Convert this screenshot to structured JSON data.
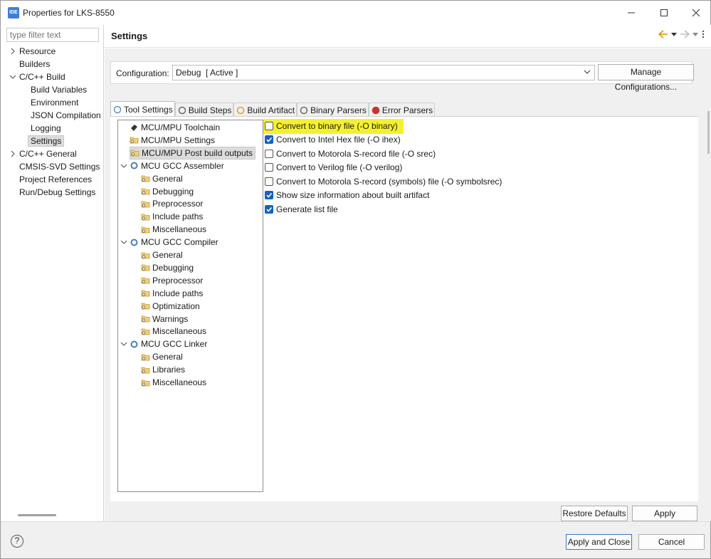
{
  "window": {
    "app_icon_text": "IDE",
    "title": "Properties for LKS-8550"
  },
  "left": {
    "filter_placeholder": "type filter text",
    "items": [
      {
        "label": "Resource",
        "expander": "collapsed"
      },
      {
        "label": "Builders"
      },
      {
        "label": "C/C++ Build",
        "expander": "expanded"
      },
      {
        "label": "Build Variables"
      },
      {
        "label": "Environment"
      },
      {
        "label": "JSON Compilation"
      },
      {
        "label": "Logging"
      },
      {
        "label": "Settings",
        "selected": true
      },
      {
        "label": "C/C++ General",
        "expander": "collapsed"
      },
      {
        "label": "CMSIS-SVD Settings"
      },
      {
        "label": "Project References"
      },
      {
        "label": "Run/Debug Settings"
      }
    ]
  },
  "header": {
    "title": "Settings"
  },
  "config": {
    "label": "Configuration:",
    "value": "Debug  [ Active ]",
    "manage_button": "Manage Configurations..."
  },
  "tabs": [
    {
      "label": "Tool Settings",
      "icon": "tool-settings-icon",
      "active": true
    },
    {
      "label": "Build Steps",
      "icon": "build-steps-icon"
    },
    {
      "label": "Build Artifact",
      "icon": "build-artifact-icon"
    },
    {
      "label": "Binary Parsers",
      "icon": "binary-parsers-icon"
    },
    {
      "label": "Error Parsers",
      "icon": "error-parsers-icon"
    }
  ],
  "tool_tree": [
    {
      "label": "MCU/MPU Toolchain",
      "level": 1,
      "icon": "toolchain-icon"
    },
    {
      "label": "MCU/MPU Settings",
      "level": 1,
      "icon": "folder-gear-icon"
    },
    {
      "label": "MCU/MPU Post build outputs",
      "level": 1,
      "icon": "folder-gear-icon",
      "selected": true
    },
    {
      "label": "MCU GCC Assembler",
      "level": 1,
      "icon": "tool-gear-icon",
      "expander": "expanded"
    },
    {
      "label": "General",
      "level": 2,
      "icon": "folder-gear-icon"
    },
    {
      "label": "Debugging",
      "level": 2,
      "icon": "folder-gear-icon"
    },
    {
      "label": "Preprocessor",
      "level": 2,
      "icon": "folder-gear-icon"
    },
    {
      "label": "Include paths",
      "level": 2,
      "icon": "folder-gear-icon"
    },
    {
      "label": "Miscellaneous",
      "level": 2,
      "icon": "folder-gear-icon"
    },
    {
      "label": "MCU GCC Compiler",
      "level": 1,
      "icon": "tool-gear-icon",
      "expander": "expanded"
    },
    {
      "label": "General",
      "level": 2,
      "icon": "folder-gear-icon"
    },
    {
      "label": "Debugging",
      "level": 2,
      "icon": "folder-gear-icon"
    },
    {
      "label": "Preprocessor",
      "level": 2,
      "icon": "folder-gear-icon"
    },
    {
      "label": "Include paths",
      "level": 2,
      "icon": "folder-gear-icon"
    },
    {
      "label": "Optimization",
      "level": 2,
      "icon": "folder-gear-icon"
    },
    {
      "label": "Warnings",
      "level": 2,
      "icon": "folder-gear-icon"
    },
    {
      "label": "Miscellaneous",
      "level": 2,
      "icon": "folder-gear-icon"
    },
    {
      "label": "MCU GCC Linker",
      "level": 1,
      "icon": "tool-gear-icon",
      "expander": "expanded"
    },
    {
      "label": "General",
      "level": 2,
      "icon": "folder-gear-icon"
    },
    {
      "label": "Libraries",
      "level": 2,
      "icon": "folder-gear-icon"
    },
    {
      "label": "Miscellaneous",
      "level": 2,
      "icon": "folder-gear-icon"
    }
  ],
  "options": [
    {
      "label": "Convert to binary file (-O binary)",
      "checked": false,
      "highlighted": true
    },
    {
      "label": "Convert to Intel Hex file (-O ihex)",
      "checked": true
    },
    {
      "label": "Convert to Motorola S-record file (-O srec)",
      "checked": false
    },
    {
      "label": "Convert to Verilog file (-O verilog)",
      "checked": false
    },
    {
      "label": "Convert to Motorola S-record (symbols) file (-O symbolsrec)",
      "checked": false
    },
    {
      "label": "Show size information about built artifact",
      "checked": true
    },
    {
      "label": "Generate list file",
      "checked": true
    }
  ],
  "buttons": {
    "restore_defaults": "Restore Defaults",
    "apply": "Apply",
    "apply_and_close": "Apply and Close",
    "cancel": "Cancel"
  },
  "colors": {
    "highlight": "#f5f02e",
    "checkbox_checked": "#1462c4",
    "panel_bg": "#f0f0f0"
  }
}
